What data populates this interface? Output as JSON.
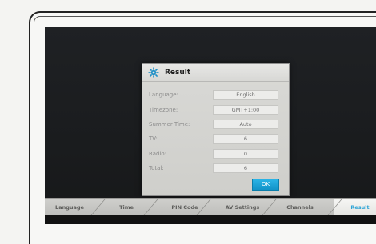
{
  "dialog": {
    "title": "Result",
    "rows": [
      {
        "label": "Language:",
        "value": "English"
      },
      {
        "label": "Timezone:",
        "value": "GMT+1:00"
      },
      {
        "label": "Summer Time:",
        "value": "Auto"
      },
      {
        "label": "TV:",
        "value": "6"
      },
      {
        "label": "Radio:",
        "value": "0"
      },
      {
        "label": "Total:",
        "value": "6"
      }
    ],
    "ok_label": "OK",
    "icon": "gear-icon",
    "accent_color": "#1ea5dc"
  },
  "tabs": [
    {
      "label": "Language",
      "active": false
    },
    {
      "label": "Time",
      "active": false
    },
    {
      "label": "PIN Code",
      "active": false
    },
    {
      "label": "AV Settings",
      "active": false
    },
    {
      "label": "Channels",
      "active": false
    },
    {
      "label": "Result",
      "active": true
    }
  ]
}
